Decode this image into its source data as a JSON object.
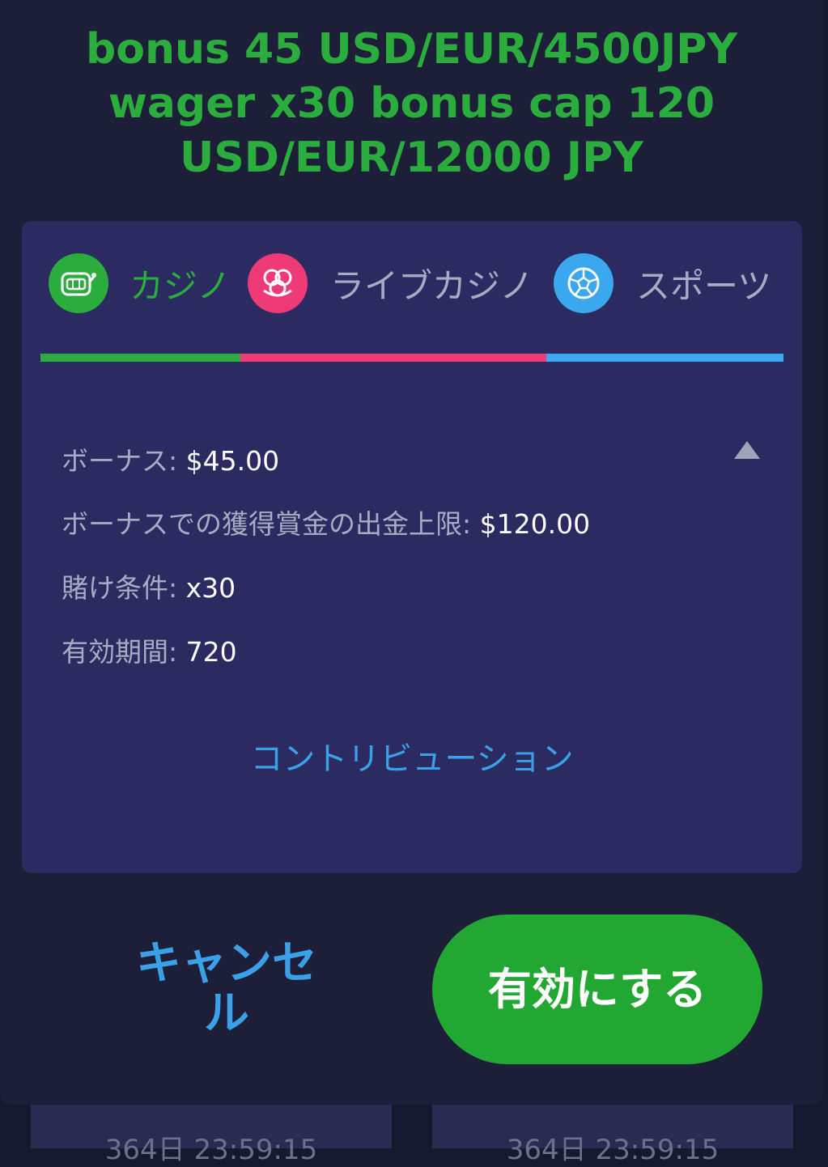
{
  "modal": {
    "title": "bonus 45 USD/EUR/4500JPY wager x30 bonus cap 120 USD/EUR/12000 JPY"
  },
  "tabs": [
    {
      "label": "カジノ",
      "icon": "slot-machine-icon",
      "color": "#2aad3c"
    },
    {
      "label": "ライブカジノ",
      "icon": "poker-chips-icon",
      "color": "#ef3a78"
    },
    {
      "label": "スポーツ",
      "icon": "soccer-ball-icon",
      "color": "#3aa7ef"
    }
  ],
  "details": {
    "bonus_label": "ボーナス:",
    "bonus_value": "$45.00",
    "cap_label": "ボーナスでの獲得賞金の出金上限:",
    "cap_value": "$120.00",
    "wager_label": "賭け条件:",
    "wager_value": "x30",
    "validity_label": "有効期間:",
    "validity_value": "720"
  },
  "contribution_link": "コントリビューション",
  "actions": {
    "cancel_label": "キャンセル",
    "activate_label": "有効にする"
  },
  "background_cards": {
    "left_timer": "364日 23:59:15",
    "right_timer": "364日 23:59:15"
  },
  "colors": {
    "green": "#2aad3c",
    "pink": "#ef3a78",
    "blue": "#3aa7ef",
    "card": "#2b2b62",
    "modal": "#1c1f37"
  }
}
